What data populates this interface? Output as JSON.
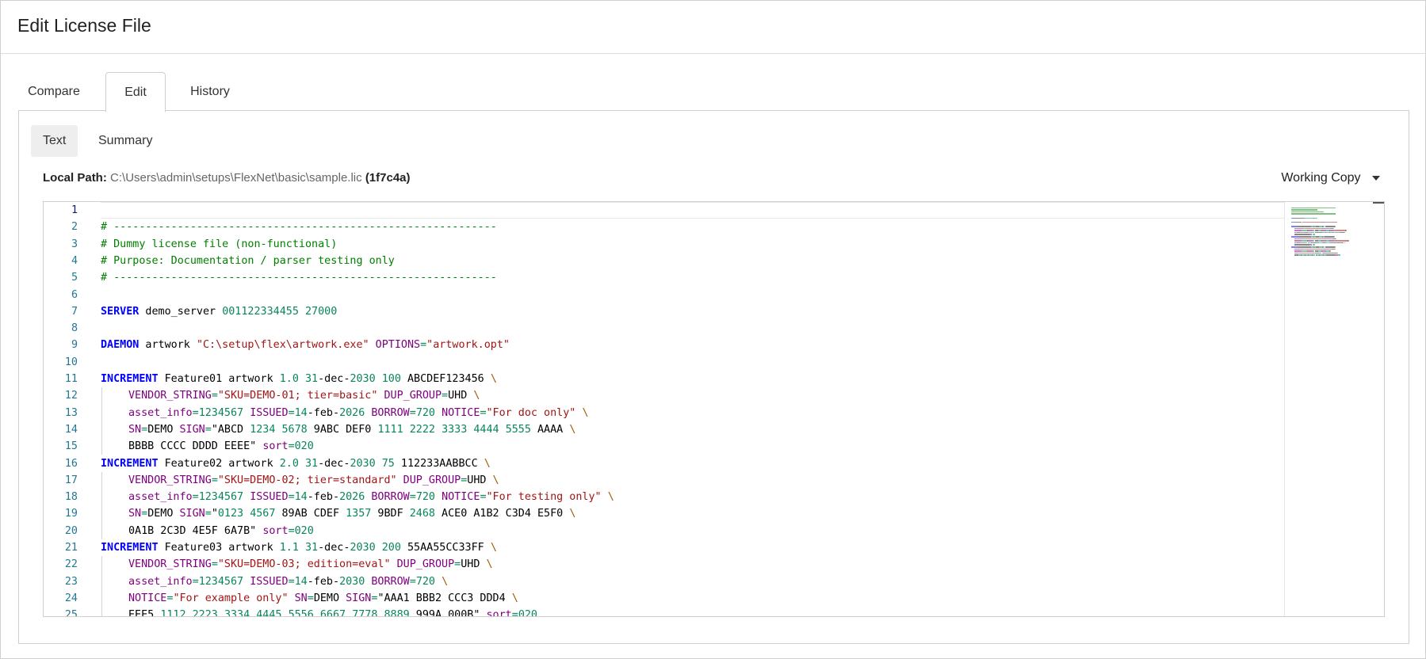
{
  "window": {
    "title": "Edit License File"
  },
  "tabs": [
    {
      "label": "Compare",
      "active": false
    },
    {
      "label": "Edit",
      "active": true
    },
    {
      "label": "History",
      "active": false
    }
  ],
  "subtabs": [
    {
      "label": "Text",
      "active": true
    },
    {
      "label": "Summary",
      "active": false
    }
  ],
  "path": {
    "label": "Local Path:",
    "value": "C:\\Users\\admin\\setups\\FlexNet\\basic\\sample.lic",
    "hash": "(1f7c4a)"
  },
  "version_dropdown": {
    "label": "Working Copy"
  },
  "colors": {
    "comment": "#008000",
    "keyword": "#0000ff",
    "number": "#098658",
    "string": "#a31515",
    "attribute": "#800080",
    "line_number": "#237893"
  },
  "editor": {
    "current_line": 1,
    "lines": [
      {
        "n": "1",
        "tokens": []
      },
      {
        "n": "2",
        "tokens": [
          {
            "t": "comment",
            "v": "# ------------------------------------------------------------"
          }
        ]
      },
      {
        "n": "3",
        "tokens": [
          {
            "t": "comment",
            "v": "# Dummy license file (non-functional)"
          }
        ]
      },
      {
        "n": "4",
        "tokens": [
          {
            "t": "comment",
            "v": "# Purpose: Documentation / parser testing only"
          }
        ]
      },
      {
        "n": "5",
        "tokens": [
          {
            "t": "comment",
            "v": "# ------------------------------------------------------------"
          }
        ]
      },
      {
        "n": "6",
        "tokens": []
      },
      {
        "n": "7",
        "tokens": [
          {
            "t": "keyword",
            "v": "SERVER"
          },
          {
            "t": "plain",
            "v": " demo_server "
          },
          {
            "t": "num",
            "v": "001122334455"
          },
          {
            "t": "plain",
            "v": " "
          },
          {
            "t": "num",
            "v": "27000"
          }
        ]
      },
      {
        "n": "8",
        "tokens": []
      },
      {
        "n": "9",
        "tokens": [
          {
            "t": "keyword",
            "v": "DAEMON"
          },
          {
            "t": "plain",
            "v": " artwork "
          },
          {
            "t": "str",
            "v": "\"C:\\setup\\flex\\artwork.exe\""
          },
          {
            "t": "plain",
            "v": " "
          },
          {
            "t": "attr",
            "v": "OPTIONS"
          },
          {
            "t": "op",
            "v": "="
          },
          {
            "t": "str",
            "v": "\"artwork.opt\""
          }
        ]
      },
      {
        "n": "10",
        "tokens": []
      },
      {
        "n": "11",
        "tokens": [
          {
            "t": "keyword",
            "v": "INCREMENT"
          },
          {
            "t": "plain",
            "v": " Feature01 artwork "
          },
          {
            "t": "num",
            "v": "1.0"
          },
          {
            "t": "plain",
            "v": " "
          },
          {
            "t": "num",
            "v": "31"
          },
          {
            "t": "plain",
            "v": "-dec-"
          },
          {
            "t": "num",
            "v": "2030"
          },
          {
            "t": "plain",
            "v": " "
          },
          {
            "t": "num",
            "v": "100"
          },
          {
            "t": "plain",
            "v": " ABCDEF123456 "
          },
          {
            "t": "esc",
            "v": "\\"
          }
        ]
      },
      {
        "n": "12",
        "indent": true,
        "tokens": [
          {
            "t": "attr",
            "v": "VENDOR_STRING"
          },
          {
            "t": "op",
            "v": "="
          },
          {
            "t": "str",
            "v": "\"SKU=DEMO-01; tier=basic\""
          },
          {
            "t": "plain",
            "v": " "
          },
          {
            "t": "attr",
            "v": "DUP_GROUP"
          },
          {
            "t": "op",
            "v": "="
          },
          {
            "t": "plain",
            "v": "UHD "
          },
          {
            "t": "esc",
            "v": "\\"
          }
        ]
      },
      {
        "n": "13",
        "indent": true,
        "tokens": [
          {
            "t": "attr",
            "v": "asset_info"
          },
          {
            "t": "op",
            "v": "="
          },
          {
            "t": "num",
            "v": "1234567"
          },
          {
            "t": "plain",
            "v": " "
          },
          {
            "t": "attr",
            "v": "ISSUED"
          },
          {
            "t": "op",
            "v": "="
          },
          {
            "t": "num",
            "v": "14"
          },
          {
            "t": "plain",
            "v": "-feb-"
          },
          {
            "t": "num",
            "v": "2026"
          },
          {
            "t": "plain",
            "v": " "
          },
          {
            "t": "attr",
            "v": "BORROW"
          },
          {
            "t": "op",
            "v": "="
          },
          {
            "t": "num",
            "v": "720"
          },
          {
            "t": "plain",
            "v": " "
          },
          {
            "t": "attr",
            "v": "NOTICE"
          },
          {
            "t": "op",
            "v": "="
          },
          {
            "t": "str",
            "v": "\"For doc only\""
          },
          {
            "t": "plain",
            "v": " "
          },
          {
            "t": "esc",
            "v": "\\"
          }
        ]
      },
      {
        "n": "14",
        "indent": true,
        "tokens": [
          {
            "t": "attr",
            "v": "SN"
          },
          {
            "t": "op",
            "v": "="
          },
          {
            "t": "plain",
            "v": "DEMO "
          },
          {
            "t": "attr",
            "v": "SIGN"
          },
          {
            "t": "op",
            "v": "="
          },
          {
            "t": "plain",
            "v": "\"ABCD "
          },
          {
            "t": "num",
            "v": "1234"
          },
          {
            "t": "plain",
            "v": " "
          },
          {
            "t": "num",
            "v": "5678"
          },
          {
            "t": "plain",
            "v": " 9ABC DEF0 "
          },
          {
            "t": "num",
            "v": "1111"
          },
          {
            "t": "plain",
            "v": " "
          },
          {
            "t": "num",
            "v": "2222"
          },
          {
            "t": "plain",
            "v": " "
          },
          {
            "t": "num",
            "v": "3333"
          },
          {
            "t": "plain",
            "v": " "
          },
          {
            "t": "num",
            "v": "4444"
          },
          {
            "t": "plain",
            "v": " "
          },
          {
            "t": "num",
            "v": "5555"
          },
          {
            "t": "plain",
            "v": " AAAA "
          },
          {
            "t": "esc",
            "v": "\\"
          }
        ]
      },
      {
        "n": "15",
        "indent": true,
        "tokens": [
          {
            "t": "plain",
            "v": "BBBB CCCC DDDD EEEE\" "
          },
          {
            "t": "attr",
            "v": "sort"
          },
          {
            "t": "op",
            "v": "="
          },
          {
            "t": "num",
            "v": "020"
          }
        ]
      },
      {
        "n": "16",
        "tokens": [
          {
            "t": "keyword",
            "v": "INCREMENT"
          },
          {
            "t": "plain",
            "v": " Feature02 artwork "
          },
          {
            "t": "num",
            "v": "2.0"
          },
          {
            "t": "plain",
            "v": " "
          },
          {
            "t": "num",
            "v": "31"
          },
          {
            "t": "plain",
            "v": "-dec-"
          },
          {
            "t": "num",
            "v": "2030"
          },
          {
            "t": "plain",
            "v": " "
          },
          {
            "t": "num",
            "v": "75"
          },
          {
            "t": "plain",
            "v": " 112233AABBCC "
          },
          {
            "t": "esc",
            "v": "\\"
          }
        ]
      },
      {
        "n": "17",
        "indent": true,
        "tokens": [
          {
            "t": "attr",
            "v": "VENDOR_STRING"
          },
          {
            "t": "op",
            "v": "="
          },
          {
            "t": "str",
            "v": "\"SKU=DEMO-02; tier=standard\""
          },
          {
            "t": "plain",
            "v": " "
          },
          {
            "t": "attr",
            "v": "DUP_GROUP"
          },
          {
            "t": "op",
            "v": "="
          },
          {
            "t": "plain",
            "v": "UHD "
          },
          {
            "t": "esc",
            "v": "\\"
          }
        ]
      },
      {
        "n": "18",
        "indent": true,
        "tokens": [
          {
            "t": "attr",
            "v": "asset_info"
          },
          {
            "t": "op",
            "v": "="
          },
          {
            "t": "num",
            "v": "1234567"
          },
          {
            "t": "plain",
            "v": " "
          },
          {
            "t": "attr",
            "v": "ISSUED"
          },
          {
            "t": "op",
            "v": "="
          },
          {
            "t": "num",
            "v": "14"
          },
          {
            "t": "plain",
            "v": "-feb-"
          },
          {
            "t": "num",
            "v": "2026"
          },
          {
            "t": "plain",
            "v": " "
          },
          {
            "t": "attr",
            "v": "BORROW"
          },
          {
            "t": "op",
            "v": "="
          },
          {
            "t": "num",
            "v": "720"
          },
          {
            "t": "plain",
            "v": " "
          },
          {
            "t": "attr",
            "v": "NOTICE"
          },
          {
            "t": "op",
            "v": "="
          },
          {
            "t": "str",
            "v": "\"For testing only\""
          },
          {
            "t": "plain",
            "v": " "
          },
          {
            "t": "esc",
            "v": "\\"
          }
        ]
      },
      {
        "n": "19",
        "indent": true,
        "tokens": [
          {
            "t": "attr",
            "v": "SN"
          },
          {
            "t": "op",
            "v": "="
          },
          {
            "t": "plain",
            "v": "DEMO "
          },
          {
            "t": "attr",
            "v": "SIGN"
          },
          {
            "t": "op",
            "v": "="
          },
          {
            "t": "plain",
            "v": "\""
          },
          {
            "t": "num",
            "v": "0123"
          },
          {
            "t": "plain",
            "v": " "
          },
          {
            "t": "num",
            "v": "4567"
          },
          {
            "t": "plain",
            "v": " 89AB CDEF "
          },
          {
            "t": "num",
            "v": "1357"
          },
          {
            "t": "plain",
            "v": " 9BDF "
          },
          {
            "t": "num",
            "v": "2468"
          },
          {
            "t": "plain",
            "v": " ACE0 A1B2 C3D4 E5F0 "
          },
          {
            "t": "esc",
            "v": "\\"
          }
        ]
      },
      {
        "n": "20",
        "indent": true,
        "tokens": [
          {
            "t": "plain",
            "v": "0A1B 2C3D 4E5F 6A7B\" "
          },
          {
            "t": "attr",
            "v": "sort"
          },
          {
            "t": "op",
            "v": "="
          },
          {
            "t": "num",
            "v": "020"
          }
        ]
      },
      {
        "n": "21",
        "tokens": [
          {
            "t": "keyword",
            "v": "INCREMENT"
          },
          {
            "t": "plain",
            "v": " Feature03 artwork "
          },
          {
            "t": "num",
            "v": "1.1"
          },
          {
            "t": "plain",
            "v": " "
          },
          {
            "t": "num",
            "v": "31"
          },
          {
            "t": "plain",
            "v": "-dec-"
          },
          {
            "t": "num",
            "v": "2030"
          },
          {
            "t": "plain",
            "v": " "
          },
          {
            "t": "num",
            "v": "200"
          },
          {
            "t": "plain",
            "v": " 55AA55CC33FF "
          },
          {
            "t": "esc",
            "v": "\\"
          }
        ]
      },
      {
        "n": "22",
        "indent": true,
        "tokens": [
          {
            "t": "attr",
            "v": "VENDOR_STRING"
          },
          {
            "t": "op",
            "v": "="
          },
          {
            "t": "str",
            "v": "\"SKU=DEMO-03; edition=eval\""
          },
          {
            "t": "plain",
            "v": " "
          },
          {
            "t": "attr",
            "v": "DUP_GROUP"
          },
          {
            "t": "op",
            "v": "="
          },
          {
            "t": "plain",
            "v": "UHD "
          },
          {
            "t": "esc",
            "v": "\\"
          }
        ]
      },
      {
        "n": "23",
        "indent": true,
        "tokens": [
          {
            "t": "attr",
            "v": "asset_info"
          },
          {
            "t": "op",
            "v": "="
          },
          {
            "t": "num",
            "v": "1234567"
          },
          {
            "t": "plain",
            "v": " "
          },
          {
            "t": "attr",
            "v": "ISSUED"
          },
          {
            "t": "op",
            "v": "="
          },
          {
            "t": "num",
            "v": "14"
          },
          {
            "t": "plain",
            "v": "-feb-"
          },
          {
            "t": "num",
            "v": "2030"
          },
          {
            "t": "plain",
            "v": " "
          },
          {
            "t": "attr",
            "v": "BORROW"
          },
          {
            "t": "op",
            "v": "="
          },
          {
            "t": "num",
            "v": "720"
          },
          {
            "t": "plain",
            "v": " "
          },
          {
            "t": "esc",
            "v": "\\"
          }
        ]
      },
      {
        "n": "24",
        "indent": true,
        "tokens": [
          {
            "t": "attr",
            "v": "NOTICE"
          },
          {
            "t": "op",
            "v": "="
          },
          {
            "t": "str",
            "v": "\"For example only\""
          },
          {
            "t": "plain",
            "v": " "
          },
          {
            "t": "attr",
            "v": "SN"
          },
          {
            "t": "op",
            "v": "="
          },
          {
            "t": "plain",
            "v": "DEMO "
          },
          {
            "t": "attr",
            "v": "SIGN"
          },
          {
            "t": "op",
            "v": "="
          },
          {
            "t": "plain",
            "v": "\"AAA1 BBB2 CCC3 DDD4 "
          },
          {
            "t": "esc",
            "v": "\\"
          }
        ]
      },
      {
        "n": "25",
        "indent": true,
        "tokens": [
          {
            "t": "plain",
            "v": "EEE5 "
          },
          {
            "t": "num",
            "v": "1112"
          },
          {
            "t": "plain",
            "v": " "
          },
          {
            "t": "num",
            "v": "2223"
          },
          {
            "t": "plain",
            "v": " "
          },
          {
            "t": "num",
            "v": "3334"
          },
          {
            "t": "plain",
            "v": " "
          },
          {
            "t": "num",
            "v": "4445"
          },
          {
            "t": "plain",
            "v": " "
          },
          {
            "t": "num",
            "v": "5556"
          },
          {
            "t": "plain",
            "v": " "
          },
          {
            "t": "num",
            "v": "6667"
          },
          {
            "t": "plain",
            "v": " "
          },
          {
            "t": "num",
            "v": "7778"
          },
          {
            "t": "plain",
            "v": " "
          },
          {
            "t": "num",
            "v": "8889"
          },
          {
            "t": "plain",
            "v": " 999A 000B\" "
          },
          {
            "t": "attr",
            "v": "sort"
          },
          {
            "t": "op",
            "v": "="
          },
          {
            "t": "num",
            "v": "020"
          }
        ]
      }
    ]
  }
}
